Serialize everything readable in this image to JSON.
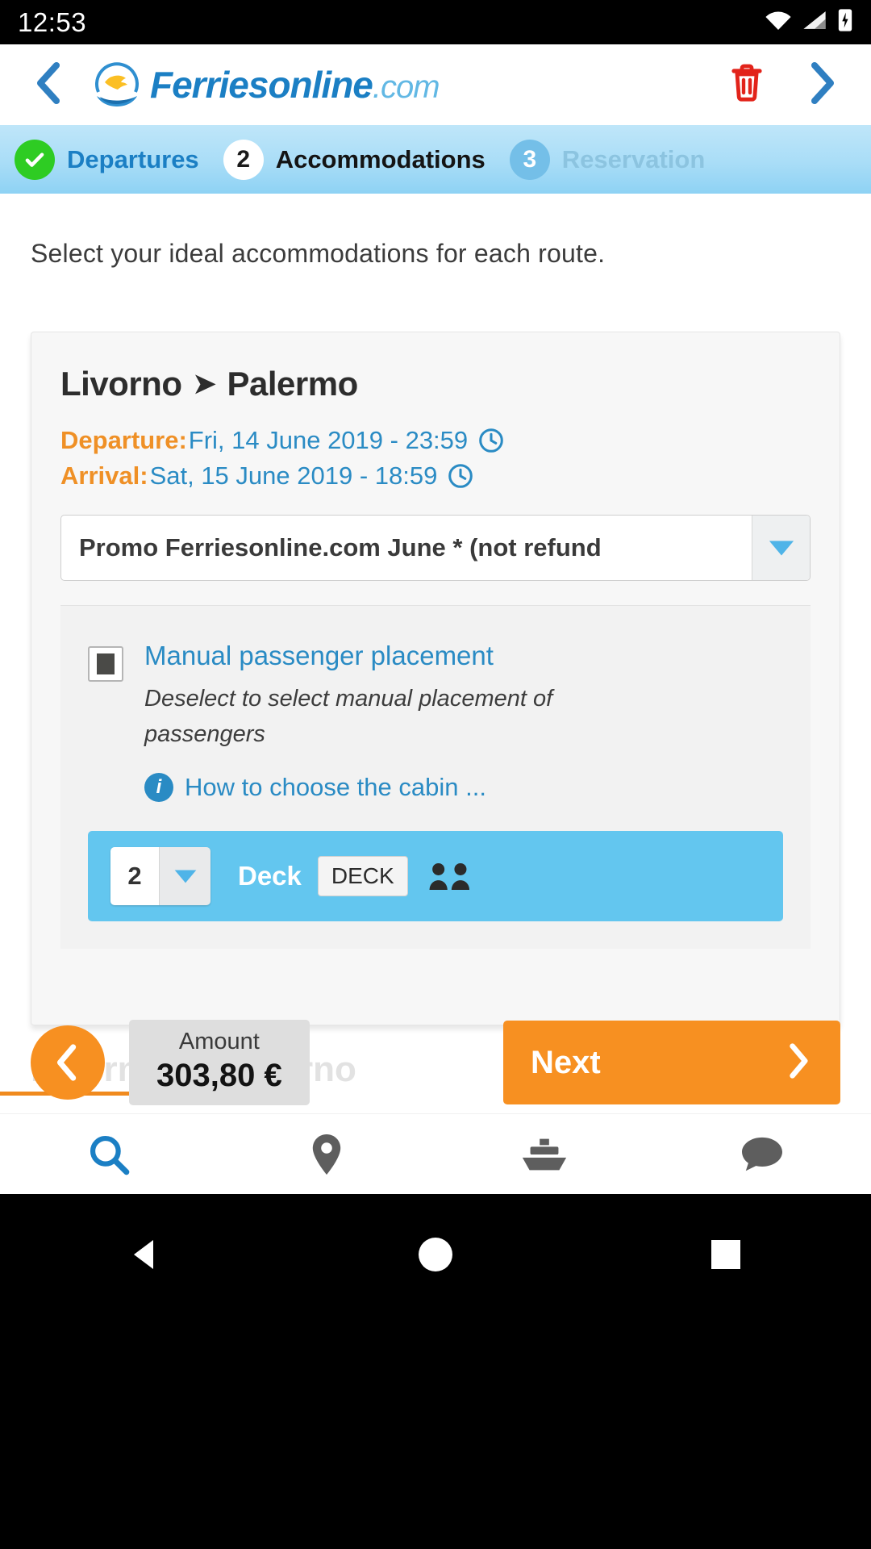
{
  "status_bar": {
    "time": "12:53",
    "icons": [
      "wifi-icon",
      "cellular-signal-icon",
      "battery-charging-icon"
    ]
  },
  "header": {
    "back_icon": "chevron-left-icon",
    "logo": {
      "brand": "Ferries",
      "brand2": "online",
      "tld": ".com",
      "mark": "dolphin-wave-logo-icon"
    },
    "delete_icon": "trash-icon",
    "forward_icon": "chevron-right-icon",
    "accent_blue": "#1b7fc4",
    "delete_red": "#e2231a"
  },
  "stepper": {
    "steps": [
      {
        "marker": "check",
        "number": "",
        "label": "Departures",
        "state": "done"
      },
      {
        "marker": "number",
        "number": "2",
        "label": "Accommodations",
        "state": "current"
      },
      {
        "marker": "number",
        "number": "3",
        "label": "Reservation",
        "state": "future"
      }
    ],
    "done_color": "#2ecc23",
    "band_color": "#a9ddf7"
  },
  "main": {
    "intro": "Select your ideal accommodations for each route.",
    "card": {
      "route": {
        "from": "Livorno",
        "arrow": "➤",
        "to": "Palermo"
      },
      "departure": {
        "key": "Departure",
        "separator": ":",
        "value": "Fri, 14 June 2019 - 23:59",
        "icon": "clock-icon"
      },
      "arrival": {
        "key": "Arrival",
        "separator": ":",
        "value": "Sat, 15 June 2019 - 18:59",
        "icon": "clock-icon"
      },
      "fare_select": {
        "value": "Promo Ferriesonline.com June * (not refund",
        "arrow_icon": "triangle-down-icon"
      },
      "placement": {
        "checkbox_state": "checked",
        "title": "Manual passenger placement",
        "hint": "Deselect to select manual placement of passengers",
        "info_icon": "info-circle-icon",
        "info_link": "How to choose the cabin ..."
      },
      "deck_row": {
        "quantity": "2",
        "qty_arrow_icon": "triangle-down-icon",
        "label": "Deck",
        "badge": "DECK",
        "pax_icon": "two-passengers-icon",
        "row_color": "#63c6ef"
      }
    },
    "ghost_route": {
      "from": "Palermo",
      "arrow": "➤",
      "to": "Livorno"
    }
  },
  "footer": {
    "back_icon": "chevron-left-icon",
    "amount_label": "Amount",
    "amount_value": "303,80 €",
    "next_label": "Next",
    "next_icon": "chevron-right-icon",
    "accent_orange": "#f79021"
  },
  "tabbar": {
    "items": [
      {
        "icon": "search-icon",
        "active": true
      },
      {
        "icon": "location-pin-icon",
        "active": false
      },
      {
        "icon": "ship-icon",
        "active": false
      },
      {
        "icon": "chat-bubble-icon",
        "active": false
      }
    ],
    "active_color": "#1b7fc4",
    "inactive_color": "#606060"
  },
  "android_nav": {
    "back_icon": "triangle-back-icon",
    "home_icon": "circle-home-icon",
    "recents_icon": "square-recents-icon"
  }
}
